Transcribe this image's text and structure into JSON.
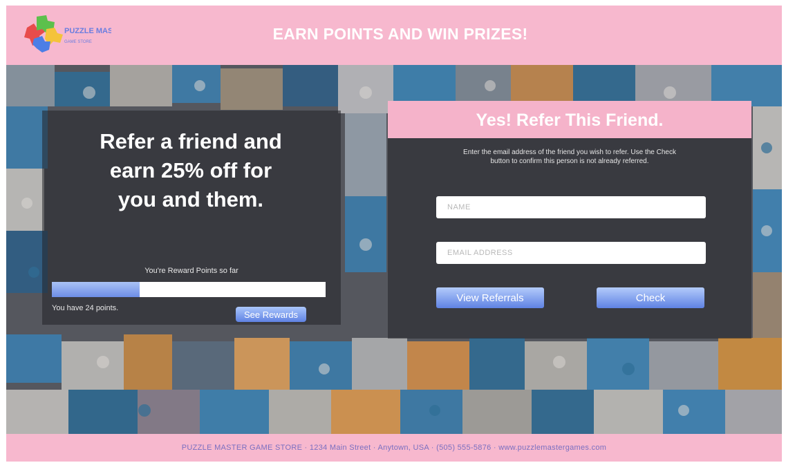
{
  "header": {
    "logo_name": "PUZZLE MASTER",
    "logo_sub": "GAME STORE",
    "title": "EARN POINTS AND WIN PRIZES!"
  },
  "left": {
    "refer_line1": "Refer a friend and",
    "refer_line2": "earn 25% off for",
    "refer_line3": "you and them.",
    "points_caption": "You're Reward Points so far",
    "progress_fraction": 0.32,
    "points_text": "You have 24 points.",
    "rewards_button": "See Rewards"
  },
  "right": {
    "title": "Yes! Refer This Friend.",
    "instructions": "Enter the email address of the friend you wish to refer. Use the Check button to confirm this person is not already referred.",
    "name_placeholder": "NAME",
    "email_placeholder": "EMAIL ADDRESS",
    "view_button": "View Referrals",
    "check_button": "Check"
  },
  "footer": {
    "text": "PUZZLE MASTER GAME STORE · 1234 Main Street · Anytown, USA · (505) 555-5876 · www.puzzlemastergames.com"
  },
  "colors": {
    "pink": "#f7b8ce",
    "button_blue": "#6d8de6",
    "footer_text": "#7a6fc0"
  }
}
